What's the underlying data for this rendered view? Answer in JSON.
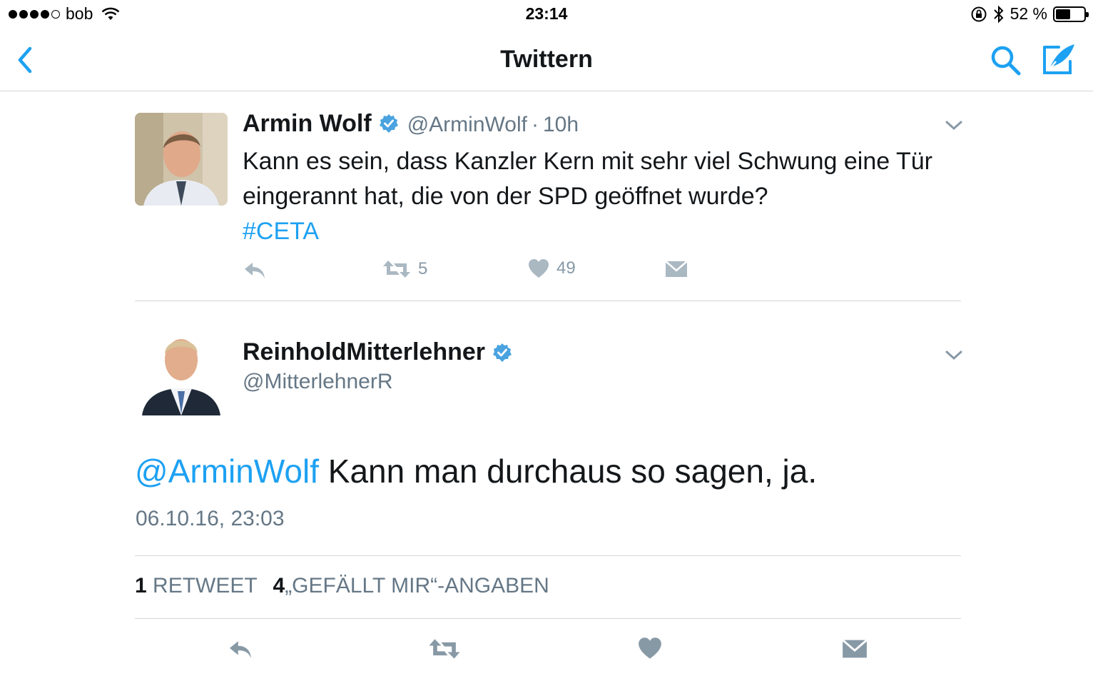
{
  "status_bar": {
    "carrier": "bob",
    "time": "23:14",
    "battery": "52 %",
    "battery_level": 0.52
  },
  "nav": {
    "title": "Twittern",
    "back_icon": "chevron-left-icon",
    "search_icon": "search-icon",
    "compose_icon": "compose-tweet-icon"
  },
  "tweet1": {
    "name": "Armin Wolf",
    "handle": "@ArminWolf",
    "separator": "·",
    "age": "10h",
    "text": "Kann es sein, dass Kanzler Kern mit sehr viel Schwung eine Tür eingerannt hat, die von der SPD geöffnet wurde?",
    "hashtag": "#CETA",
    "retweets": "5",
    "likes": "49"
  },
  "tweet2": {
    "name": "ReinholdMitterlehner",
    "handle": "@MitterlehnerR",
    "mention": "@ArminWolf",
    "text": " Kann man durchaus so sagen, ja.",
    "date": "06.10.16, 23:03",
    "retweet_count": "1",
    "retweet_label": "RETWEET",
    "like_count": "4",
    "like_label": "„GEFÄLLT MIR“-ANGABEN"
  },
  "colors": {
    "accent": "#1da1f2",
    "secondary_text": "#657786",
    "action_icon": "#aab8c2",
    "divider": "#d6d6d6"
  }
}
